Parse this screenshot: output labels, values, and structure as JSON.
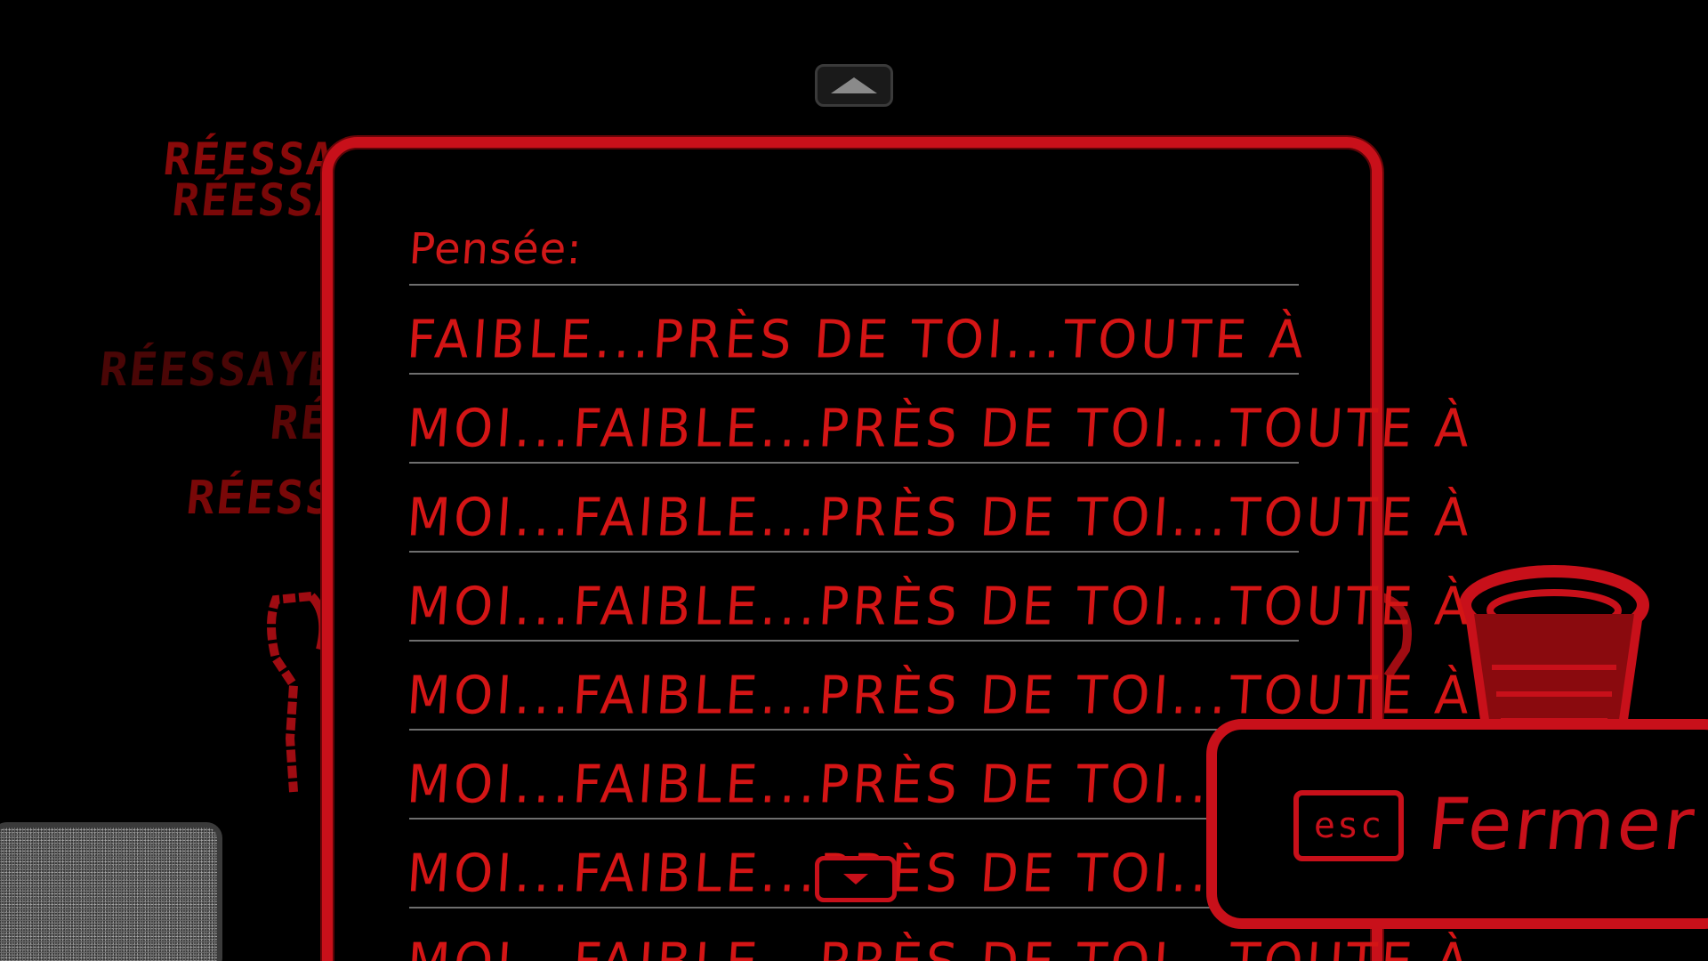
{
  "background_retry_texts": [
    {
      "text": "RÉESSAYER",
      "color": "#8a0a0a"
    },
    {
      "text": "RÉESSAYER",
      "color": "#7a0808"
    },
    {
      "text": "RÉESSAYER",
      "color": "#4a0606"
    },
    {
      "text": "RÉESSAYER",
      "color": "#5a0606"
    },
    {
      "text": "RÉESSAYER",
      "color": "#7a0808"
    }
  ],
  "journal": {
    "label": "Pensée:",
    "lines": [
      "FAIBLE...PRÈS DE TOI...TOUTE À",
      "MOI...FAIBLE...PRÈS DE TOI...TOUTE À",
      "MOI...FAIBLE...PRÈS DE TOI...TOUTE À",
      "MOI...FAIBLE...PRÈS DE TOI...TOUTE À",
      "MOI...FAIBLE...PRÈS DE TOI...TOUTE À",
      "MOI...FAIBLE...PRÈS DE TOI...TOUTE À",
      "MOI...FAIBLE...PRÈS DE TOI...TOUTE À",
      "MOI...FAIBLE...PRÈS DE TOI...TOUTE À"
    ]
  },
  "close": {
    "key": "esc",
    "label": "Fermer"
  },
  "icons": {
    "scroll_up": "arrow-up-icon",
    "scroll_down": "arrow-down-icon",
    "bin": "trash-bin-icon",
    "hook": "hook-icon"
  },
  "colors": {
    "accent": "#c8101a",
    "text": "#d41515",
    "rule": "#6e6e6e",
    "background": "#000000"
  }
}
